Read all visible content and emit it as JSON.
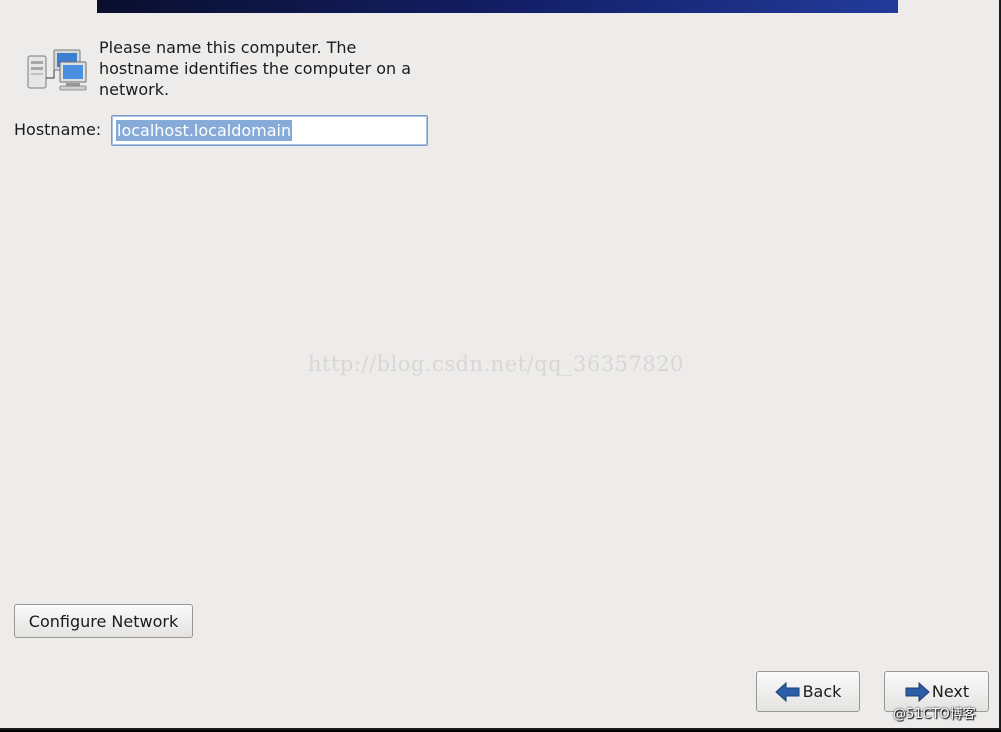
{
  "intro": {
    "text": "Please name this computer.  The hostname identifies the computer on a network."
  },
  "hostname": {
    "label": "Hostname:",
    "value": "localhost.localdomain"
  },
  "watermark": "http://blog.csdn.net/qq_36357820",
  "buttons": {
    "configure_network": "Configure Network",
    "back": "Back",
    "next": "Next"
  },
  "corner_watermark": "@51CTO博客",
  "icons": {
    "network": "network-computers-icon",
    "back": "left-arrow-icon",
    "next": "right-arrow-icon"
  },
  "colors": {
    "background": "#edeceb",
    "banner": "#14206a",
    "selection": "#86abd9",
    "arrow": "#2c5ea8"
  }
}
